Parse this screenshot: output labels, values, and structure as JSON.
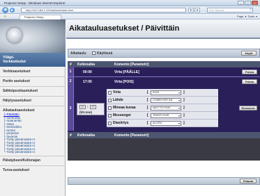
{
  "browser": {
    "window_title": "Projector Setup - Windows Internet Explorer",
    "url": "http://192.168.1.10/html/schedule.html",
    "web_search_placeholder": "Live Search",
    "tab_title": "Projector Setup",
    "toolbar_tools": "Page ▾   Tools ▾"
  },
  "sidebar": {
    "header_line1": "Ylläpi-",
    "header_line2": "Verkkotiedot",
    "menu": [
      "Verkkoasetukset",
      "Portin asetukset",
      "Sähköpostiasetukset",
      "Hälytysasetukset",
      "Aikatauluasetukset"
    ],
    "subitems": [
      "Päivittäin",
      "sunnuntai",
      "maanantai",
      "tiistai",
      "keskiviikko",
      "torstai",
      "perjantai",
      "lauantai",
      "Tietty päivämäärä nr",
      "Tietty päivämäärä nr",
      "Tietty päivämäärä nr",
      "Tietty päivämäärä nr",
      "Tietty päivämäärä nr"
    ],
    "bottom_menu": [
      "Päiväyksen/Kellonajan",
      "Turva-asetukset"
    ]
  },
  "main": {
    "title": "Aikatauluasetukset / Päivittäin",
    "schedule_label": "Aikataulu",
    "enabled_label": "Käytössä",
    "apply_button": "Käytä",
    "table": {
      "headers": [
        "#",
        "Kellonaika",
        "Komento [Parametri]"
      ],
      "rows": [
        {
          "num": "1",
          "time": "00:00",
          "command": "Virta [PÄÄLLE]",
          "action": "Poista"
        },
        {
          "num": "2",
          "time": "17:00",
          "command": "Virta [POIS]",
          "action": "Poista"
        }
      ],
      "new_entry": {
        "num": "3",
        "hour": "00",
        "minute": "00",
        "time_format": "(hh:mm)",
        "register_button": "Rekisteröi",
        "params": [
          {
            "name": "Virta",
            "value": "POIS"
          },
          {
            "name": "Lähde",
            "value": "COMPUTER IN1"
          },
          {
            "name": "Mineaa kuvaa",
            "value": "NÄYTTÖ POIS"
          },
          {
            "name": "Messenger",
            "value": "TEKSTI POIS"
          },
          {
            "name": "Diasiirtys",
            "value": "ALOITA"
          }
        ]
      }
    },
    "footer_button": "Palauta"
  }
}
